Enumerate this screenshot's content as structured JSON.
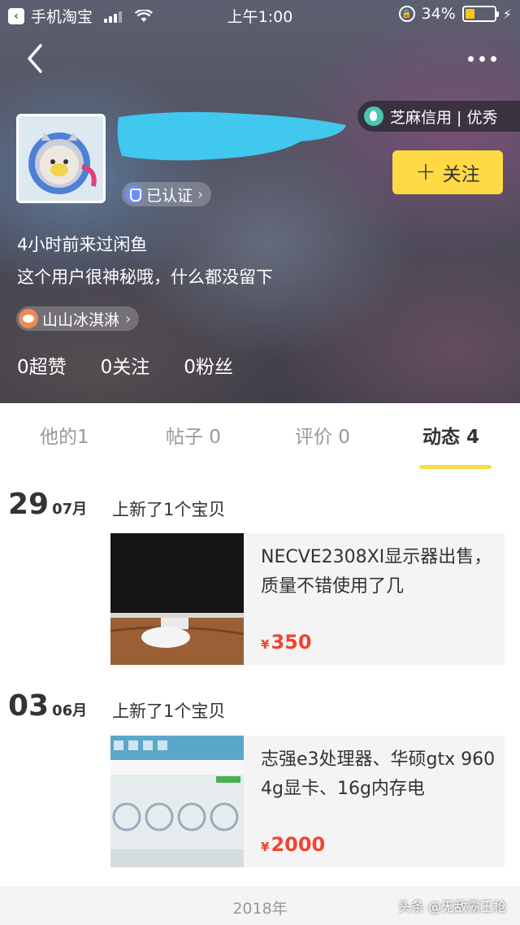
{
  "status_bar": {
    "app_name": "手机淘宝",
    "time": "上午1:00",
    "battery_percent": "34%",
    "battery_level": 0.34
  },
  "profile": {
    "credit_tag": "芝麻信用 | 优秀",
    "verified_label": "已认证",
    "follow_label": "关注",
    "last_seen": "4小时前来过闲鱼",
    "bio": "这个用户很神秘哦，什么都没留下",
    "weibo_name": "山山冰淇淋",
    "stats": [
      "0超赞",
      "0关注",
      "0粉丝"
    ]
  },
  "tabs": [
    {
      "label": "他的1"
    },
    {
      "label": "帖子 0"
    },
    {
      "label": "评价 0"
    },
    {
      "label": "动态 4",
      "active": true
    }
  ],
  "feed": [
    {
      "day": "29",
      "month": "07月",
      "caption": "上新了1个宝贝",
      "title": "NECVE2308XI显示器出售，质量不错使用了几",
      "price_symbol": "¥",
      "price": "350"
    },
    {
      "day": "03",
      "month": "06月",
      "caption": "上新了1个宝贝",
      "title": "志强e3处理器、华硕gtx 960 4g显卡、16g内存电",
      "price_symbol": "¥",
      "price": "2000"
    }
  ],
  "footer": {
    "year": "2018年",
    "watermark": "头条 @无敌霸王枪"
  },
  "colors": {
    "accent": "#ffda44",
    "price": "#f0452f"
  }
}
